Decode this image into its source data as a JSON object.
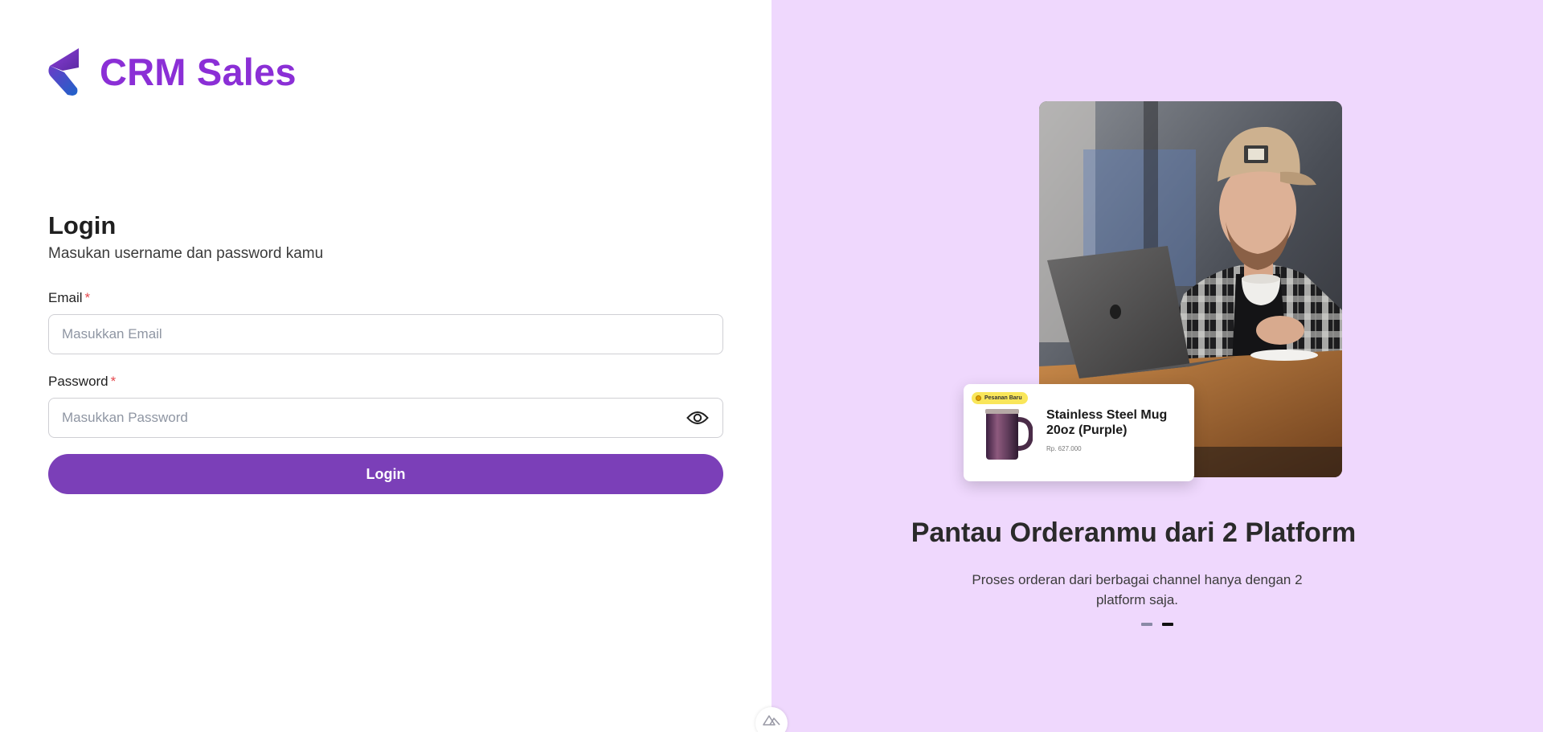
{
  "brand": {
    "name": "CRM Sales"
  },
  "login": {
    "title": "Login",
    "subtitle": "Masukan username dan password kamu",
    "email_label": "Email",
    "email_placeholder": "Masukkan Email",
    "email_value": "",
    "password_label": "Password",
    "password_placeholder": "Masukkan Password",
    "password_value": "",
    "required_mark": "*",
    "submit_label": "Login"
  },
  "promo": {
    "product": {
      "badge": "Pesanan Baru",
      "name": "Stainless Steel Mug 20oz (Purple)",
      "price": "Rp. 627.000"
    },
    "headline": "Pantau Orderanmu dari 2 Platform",
    "description": "Proses orderan dari berbagai channel hanya dengan 2 platform saja.",
    "slides": {
      "count": 2,
      "active": 2
    }
  },
  "icons": {
    "logo": "brand-logo-icon",
    "toggle_password": "eye-icon",
    "bottom_badge": "triangle-logo-icon"
  },
  "colors": {
    "brand": "#8b2fd6",
    "button": "#7b3fb8",
    "right_panel_bg": "#efd8fd",
    "required": "#e5484d"
  }
}
